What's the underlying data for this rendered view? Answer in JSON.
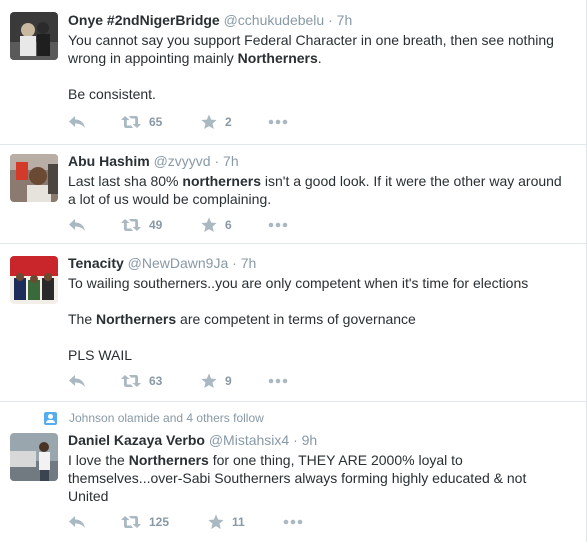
{
  "tweets": [
    {
      "fullname": "Onye #2ndNigerBridge",
      "username": "@cchukudebelu",
      "separator": "·",
      "time": "7h",
      "lines": [
        {
          "segments": [
            "You cannot say you support Federal Character in one breath, then see nothing"
          ]
        },
        {
          "segments": [
            "wrong in appointing mainly ",
            "Northerners",
            "."
          ]
        },
        {
          "segments": [
            ""
          ]
        },
        {
          "segments": [
            "Be consistent."
          ]
        }
      ],
      "retweets": "65",
      "favorites": "2"
    },
    {
      "fullname": "Abu Hashim",
      "username": "@zvyyvd",
      "separator": "·",
      "time": "7h",
      "lines": [
        {
          "segments": [
            "Last last sha 80% ",
            "northerners",
            " isn't a good look. If it were the other way around"
          ]
        },
        {
          "segments": [
            "a lot of us would be complaining."
          ]
        }
      ],
      "retweets": "49",
      "favorites": "6"
    },
    {
      "fullname": "Tenacity",
      "username": "@NewDawn9Ja",
      "separator": "·",
      "time": "7h",
      "lines": [
        {
          "segments": [
            "To wailing southerners..you are only competent when it's time for elections"
          ]
        },
        {
          "segments": [
            ""
          ]
        },
        {
          "segments": [
            "The ",
            "Northerners",
            " are competent in terms of governance"
          ]
        },
        {
          "segments": [
            ""
          ]
        },
        {
          "segments": [
            "PLS WAIL"
          ]
        }
      ],
      "retweets": "63",
      "favorites": "9"
    },
    {
      "context": "Johnson olamide and 4 others follow",
      "fullname": "Daniel Kazaya Verbo",
      "username": "@Mistahsix4",
      "separator": "·",
      "time": "9h",
      "lines": [
        {
          "segments": [
            "I love the ",
            "Northerners",
            " for one thing, THEY ARE 2000% loyal to"
          ]
        },
        {
          "segments": [
            "themselves...over-Sabi Southerners always forming highly educated & not"
          ]
        },
        {
          "segments": [
            "United"
          ]
        }
      ],
      "retweets": "125",
      "favorites": "11"
    }
  ],
  "colors": {
    "text": "#292f33",
    "muted": "#8899a6",
    "icon": "#aab8c2",
    "divider": "#e1e8ed",
    "accent": "#55acee"
  },
  "icons": {
    "reply": "reply-icon",
    "retweet": "retweet-icon",
    "favorite": "star-icon",
    "more": "more-dots-icon",
    "context": "person-follow-icon"
  }
}
